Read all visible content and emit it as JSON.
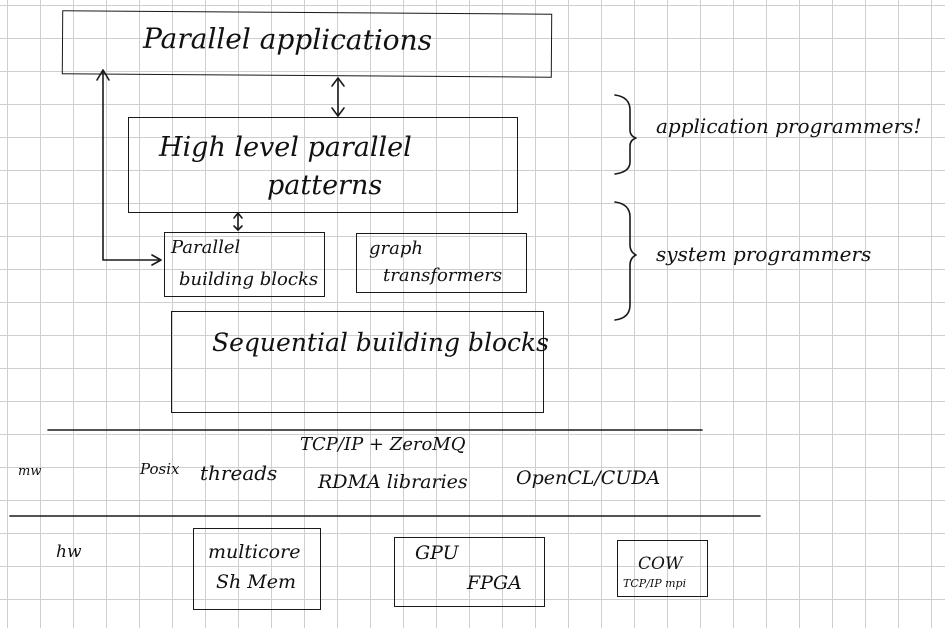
{
  "layers": {
    "applications": "Parallel applications",
    "patterns_line1": "High level parallel",
    "patterns_line2": "patterns",
    "par_blocks_line1": "Parallel",
    "par_blocks_line2": "building blocks",
    "graph_line1": "graph",
    "graph_line2": "transformers",
    "seq_blocks": "Sequential building blocks"
  },
  "side_notes": {
    "app_programmers": "application programmers!",
    "sys_programmers": "system programmers"
  },
  "middleware": {
    "label": "mw",
    "tcp": "TCP/IP + ZeroMQ",
    "posix": "Posix",
    "threads": "threads",
    "rdma": "RDMA libraries",
    "opencl": "OpenCL/CUDA"
  },
  "hardware": {
    "label": "hw",
    "multicore_line1": "multicore",
    "multicore_line2": "Sh Mem",
    "gpu": "GPU",
    "fpga": "FPGA",
    "cow": "COW",
    "cow_sub": "TCP/IP mpi"
  }
}
